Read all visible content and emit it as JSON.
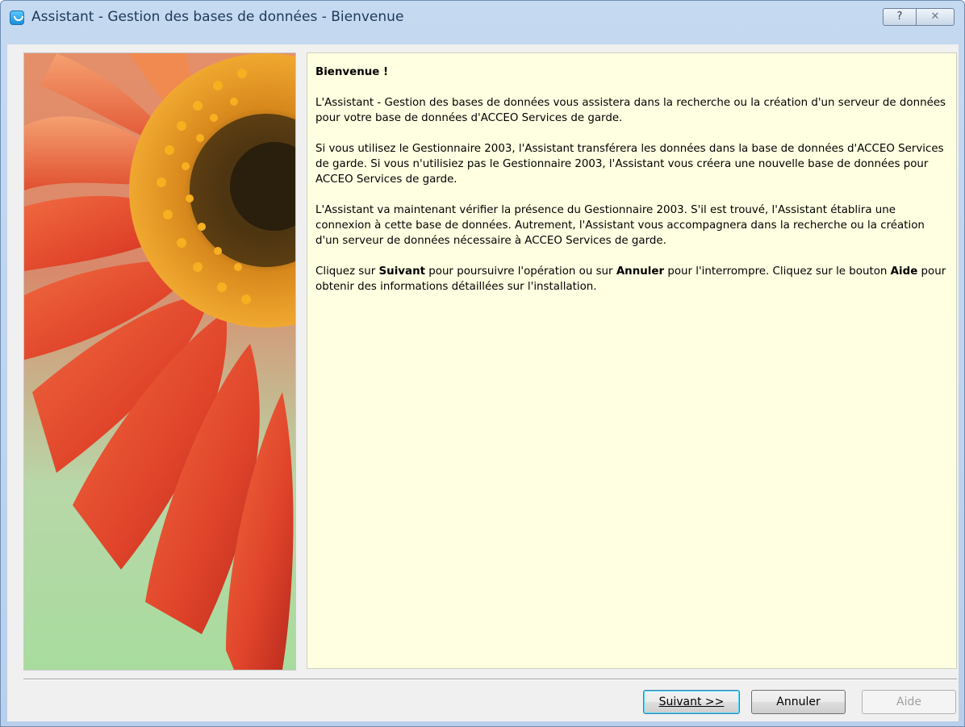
{
  "window": {
    "title": "Assistant - Gestion des bases de données - Bienvenue",
    "help_glyph": "?",
    "close_glyph": "✕"
  },
  "content": {
    "heading": "Bienvenue !",
    "p1": "L'Assistant - Gestion des bases de données vous assistera dans la recherche ou la création d'un serveur de données pour votre base de données d'ACCEO Services de garde.",
    "p2": "Si vous utilisez le Gestionnaire 2003, l'Assistant transférera les données dans la base de données d'ACCEO Services de garde. Si vous n'utilisiez pas le Gestionnaire 2003, l'Assistant vous créera une nouvelle base de données pour ACCEO Services de garde.",
    "p3": "L'Assistant va maintenant vérifier la présence du Gestionnaire 2003. S'il est trouvé, l'Assistant établira une connexion à cette base de données. Autrement, l'Assistant vous accompagnera dans la recherche ou la création d'un serveur de données nécessaire à ACCEO Services de garde.",
    "p4": {
      "part1": "Cliquez sur ",
      "bold1": "Suivant",
      "part2": " pour poursuivre l'opération ou sur ",
      "bold2": "Annuler",
      "part3": " pour l'interrompre. Cliquez sur le bouton ",
      "bold3": "Aide",
      "part4": " pour obtenir des informations détaillées sur l'installation."
    }
  },
  "buttons": {
    "next": "Suivant >>",
    "cancel": "Annuler",
    "help": "Aide"
  },
  "colors": {
    "content_background": "#ffffe1",
    "titlebar": "#c5d9f0",
    "flower_petal": "#e8502a",
    "flower_center": "#f0a020"
  }
}
